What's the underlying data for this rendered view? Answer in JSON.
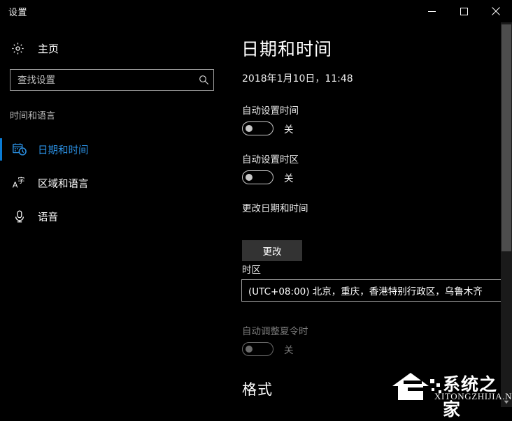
{
  "window": {
    "title": "设置",
    "controls": {
      "minimize": "最小化",
      "maximize": "最大化",
      "close": "关闭"
    }
  },
  "sidebar": {
    "home": {
      "label": "主页",
      "icon": "gear-icon"
    },
    "search": {
      "placeholder": "查找设置",
      "value": "",
      "icon": "search-icon"
    },
    "group_header": "时间和语言",
    "items": [
      {
        "label": "日期和时间",
        "icon": "calendar-clock-icon",
        "selected": true
      },
      {
        "label": "区域和语言",
        "icon": "language-a-icon",
        "selected": false
      },
      {
        "label": "语音",
        "icon": "microphone-icon",
        "selected": false
      }
    ]
  },
  "main": {
    "page_title": "日期和时间",
    "current_datetime": "2018年1月10日，11:48",
    "auto_time": {
      "label": "自动设置时间",
      "state": "关",
      "enabled": true
    },
    "auto_timezone": {
      "label": "自动设置时区",
      "state": "关",
      "enabled": true
    },
    "change_datetime": {
      "label": "更改日期和时间",
      "button": "更改"
    },
    "timezone": {
      "label": "时区",
      "value": "(UTC+08:00) 北京，重庆，香港特别行政区，乌鲁木齐"
    },
    "daylight_saving": {
      "label": "自动调整夏令时",
      "state": "关",
      "enabled": false
    },
    "format_heading": "格式"
  },
  "scrollbar": {
    "up_arrow": "▲",
    "down_arrow": "▼"
  },
  "watermark": {
    "cn": "系统之家",
    "en": "XITONGZHIJIA.NET"
  },
  "colors": {
    "accent": "#0a7bd4",
    "accent_text": "#2a8ee0",
    "background": "#000000",
    "button": "#333333",
    "border": "#9a9a9a",
    "disabled_text": "#7c7c7c"
  }
}
